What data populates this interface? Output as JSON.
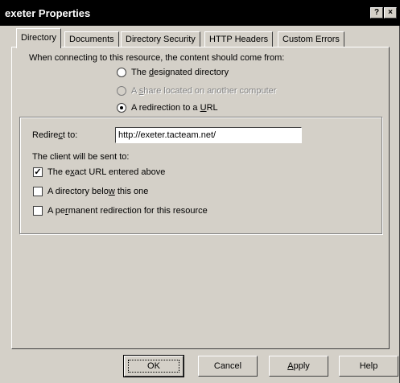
{
  "window": {
    "title": "exeter Properties",
    "help_button": "?",
    "close_button": "×"
  },
  "tabs": [
    {
      "label": "Directory",
      "active": true
    },
    {
      "label": "Documents",
      "active": false
    },
    {
      "label": "Directory Security",
      "active": false
    },
    {
      "label": "HTTP Headers",
      "active": false
    },
    {
      "label": "Custom Errors",
      "active": false
    }
  ],
  "content_source": {
    "prompt": "When connecting to this resource, the content should come from:",
    "options": [
      {
        "pre": "The ",
        "hot": "d",
        "post": "esignated directory",
        "selected": false,
        "enabled": true
      },
      {
        "pre": "A ",
        "hot": "s",
        "post": "hare located on another computer",
        "selected": false,
        "enabled": false
      },
      {
        "pre": "A redirection to a ",
        "hot": "U",
        "post": "RL",
        "selected": true,
        "enabled": true
      }
    ]
  },
  "redirect": {
    "label_pre": "Redire",
    "label_hot": "c",
    "label_post": "t to:",
    "value": "http://exeter.tacteam.net/",
    "client_text": "The client will be sent to:",
    "options": [
      {
        "pre": "The e",
        "hot": "x",
        "post": "act URL entered above",
        "checked": true
      },
      {
        "pre": "A directory belo",
        "hot": "w",
        "post": " this one",
        "checked": false
      },
      {
        "pre": "A pe",
        "hot": "r",
        "post": "manent redirection for this resource",
        "checked": false
      }
    ]
  },
  "buttons": {
    "ok": "OK",
    "cancel": "Cancel",
    "apply_hot": "A",
    "apply_post": "pply",
    "help": "Help"
  }
}
